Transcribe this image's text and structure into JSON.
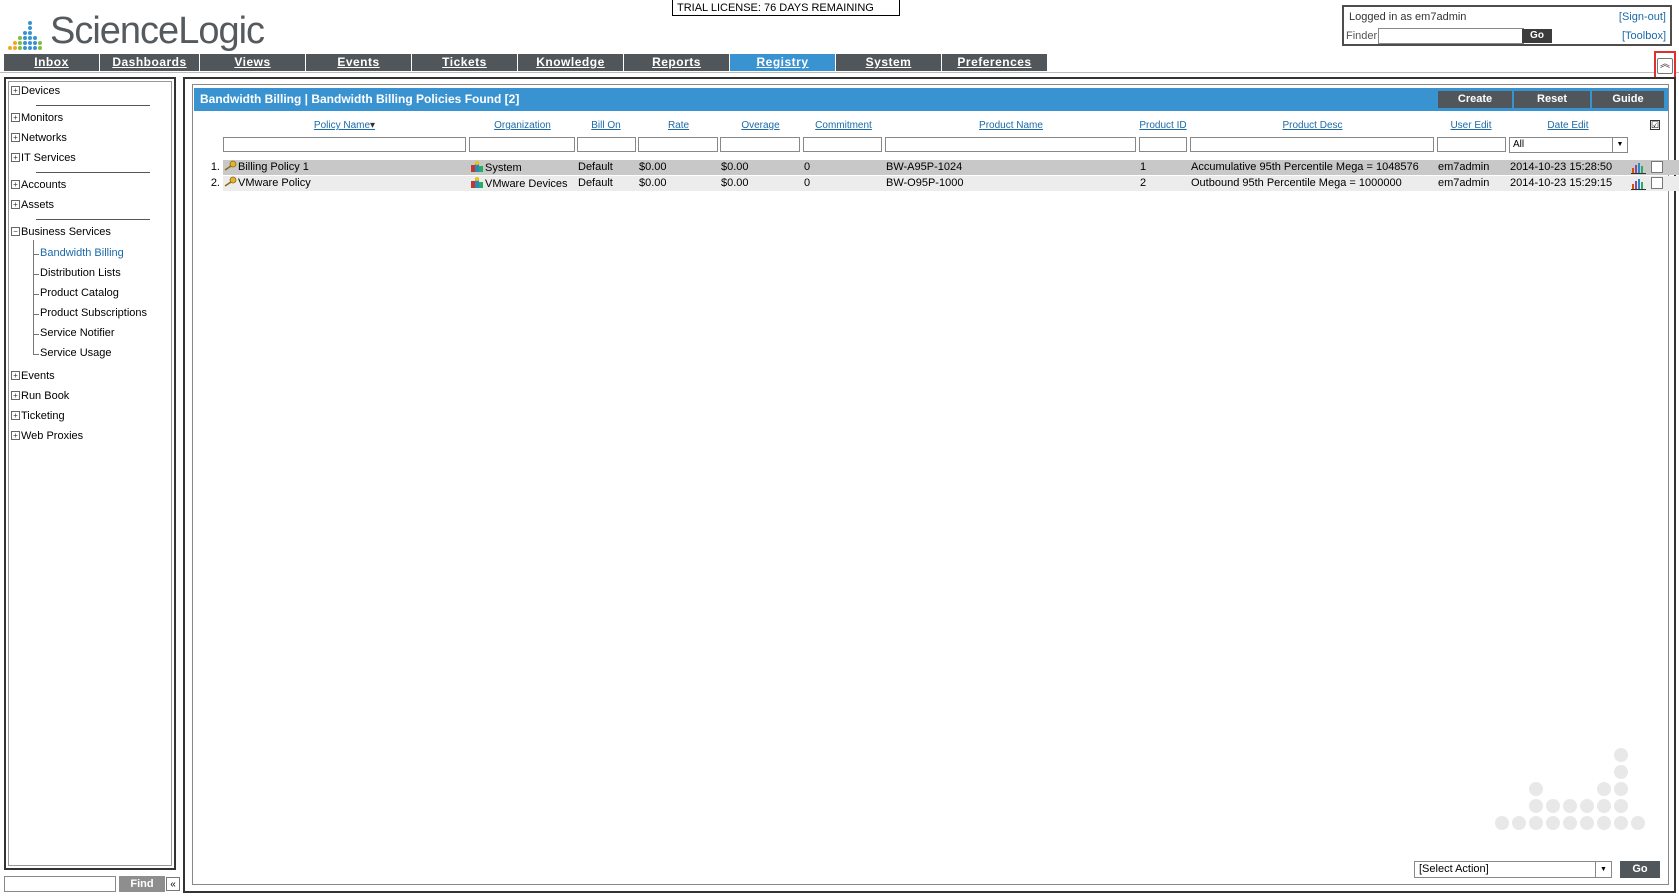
{
  "brand": {
    "logo_text": "ScienceLogic"
  },
  "trial_banner": "TRIAL LICENSE: 76 DAYS REMAINING",
  "user_box": {
    "logged_in": "Logged in as em7admin",
    "sign_out": "[Sign-out]",
    "finder_label": "Finder",
    "go_label": "Go",
    "toolbox": "[Toolbox]"
  },
  "nav": {
    "tabs": [
      {
        "label": "Inbox"
      },
      {
        "label": "Dashboards"
      },
      {
        "label": "Views"
      },
      {
        "label": "Events"
      },
      {
        "label": "Tickets"
      },
      {
        "label": "Knowledge"
      },
      {
        "label": "Reports"
      },
      {
        "label": "Registry",
        "active": true
      },
      {
        "label": "System"
      },
      {
        "label": "Preferences"
      }
    ]
  },
  "sidebar": {
    "items": [
      {
        "label": "Devices"
      },
      {
        "label": "Monitors"
      },
      {
        "label": "Networks"
      },
      {
        "label": "IT Services"
      },
      {
        "label": "Accounts"
      },
      {
        "label": "Assets"
      },
      {
        "label": "Business Services"
      },
      {
        "label": "Events"
      },
      {
        "label": "Run Book"
      },
      {
        "label": "Ticketing"
      },
      {
        "label": "Web Proxies"
      }
    ],
    "business_services_children": [
      {
        "label": "Bandwidth Billing",
        "selected": true
      },
      {
        "label": "Distribution Lists"
      },
      {
        "label": "Product Catalog"
      },
      {
        "label": "Product Subscriptions"
      },
      {
        "label": "Service Notifier"
      },
      {
        "label": "Service Usage"
      }
    ],
    "find_label": "Find",
    "collapse_symbol": "«"
  },
  "panel": {
    "title": "Bandwidth Billing | Bandwidth Billing Policies Found [2]",
    "buttons": {
      "create": "Create",
      "reset": "Reset",
      "guide": "Guide"
    },
    "columns": [
      "Policy Name",
      "Organization",
      "Bill On",
      "Rate",
      "Overage",
      "Commitment",
      "Product Name",
      "Product ID",
      "Product Desc",
      "User Edit",
      "Date Edit"
    ],
    "sort_indicator": "▾",
    "date_filter_value": "All",
    "header_check": "☑",
    "rows": [
      {
        "num": "1.",
        "policy_name": "Billing Policy 1",
        "organization": "System",
        "bill_on": "Default",
        "rate": "$0.00",
        "overage": "$0.00",
        "commitment": "0",
        "product_name": "BW-A95P-1024",
        "product_id": "1",
        "product_desc": "Accumulative 95th Percentile Mega = 1048576",
        "user_edit": "em7admin",
        "date_edit": "2014-10-23 15:28:50"
      },
      {
        "num": "2.",
        "policy_name": "VMware Policy",
        "organization": "VMware Devices",
        "bill_on": "Default",
        "rate": "$0.00",
        "overage": "$0.00",
        "commitment": "0",
        "product_name": "BW-O95P-1000",
        "product_id": "2",
        "product_desc": "Outbound 95th Percentile Mega = 1000000",
        "user_edit": "em7admin",
        "date_edit": "2014-10-23 15:29:15"
      }
    ],
    "action_select": "[Select Action]",
    "action_go": "Go"
  },
  "colors": {
    "accent_blue": "#3a93d1",
    "nav_dark": "#505659",
    "link_blue": "#1a6aa8",
    "highlight_red": "#e0302c"
  }
}
